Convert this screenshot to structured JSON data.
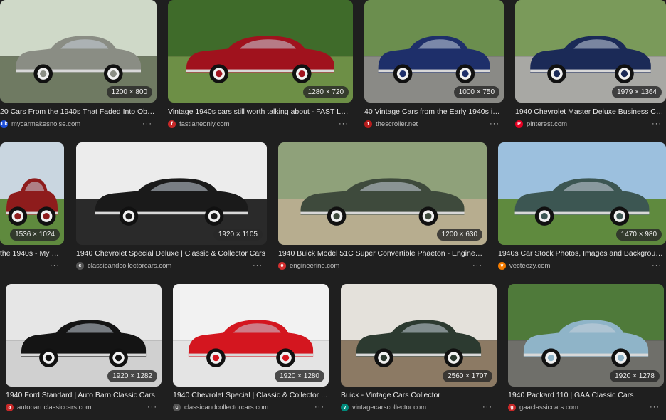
{
  "results": [
    {
      "title": "20 Cars From the 1940s That Faded Into Obs...",
      "source": "mycarmakesnoise.com",
      "dims": "1200 × 800",
      "favicon_color": "#1d4ed8",
      "favicon_label": "Tik",
      "car_color": "#8a8d84",
      "bg_sky": "#cfd9c8",
      "bg_ground": "#6f7a62"
    },
    {
      "title": "Vintage 1940s cars still worth talking about - FAST LA...",
      "source": "fastlaneonly.com",
      "dims": "1280 × 720",
      "favicon_color": "#c62828",
      "favicon_label": "f",
      "car_color": "#a0121d",
      "bg_sky": "#3f6b2a",
      "bg_ground": "#6d8f46"
    },
    {
      "title": "40 Vintage Cars from the Early 1940s in ...",
      "source": "thescroller.net",
      "dims": "1000 × 750",
      "favicon_color": "#b71c1c",
      "favicon_label": "t",
      "car_color": "#1e2f6a",
      "bg_sky": "#6b8e4e",
      "bg_ground": "#8a8a86"
    },
    {
      "title": "1940 Chevrolet Master Deluxe Business Cou...",
      "source": "pinterest.com",
      "dims": "1979 × 1364",
      "favicon_color": "#e60023",
      "favicon_label": "P",
      "car_color": "#1b2a57",
      "bg_sky": "#7a9a5a",
      "bg_ground": "#a8a8a4"
    },
    {
      "title": "the 1940s - My C...",
      "source": "",
      "dims": "1536 × 1024",
      "favicon_color": "#444",
      "favicon_label": "",
      "car_color": "#8e1c1c",
      "bg_sky": "#c9d6e0",
      "bg_ground": "#5f8a3e"
    },
    {
      "title": "1940 Chevrolet Special Deluxe | Classic & Collector Cars",
      "source": "classicandcollectorcars.com",
      "dims": "1920 × 1105",
      "favicon_color": "#555",
      "favicon_label": "c",
      "car_color": "#1a1a1a",
      "bg_sky": "#ececec",
      "bg_ground": "#2a2a2a"
    },
    {
      "title": "1940 Buick Model 51C Super Convertible Phaeton - Engineeri...",
      "source": "engineerine.com",
      "dims": "1200 × 630",
      "favicon_color": "#d32f2f",
      "favicon_label": "e",
      "car_color": "#3e4a3c",
      "bg_sky": "#8fa17a",
      "bg_ground": "#b7ad8f"
    },
    {
      "title": "1940s Car Stock Photos, Images and Backgroun...",
      "source": "vecteezy.com",
      "dims": "1470 × 980",
      "favicon_color": "#f57c00",
      "favicon_label": "v",
      "car_color": "#3c5652",
      "bg_sky": "#9cc0de",
      "bg_ground": "#5f8a3e"
    },
    {
      "title": "1940 Ford Standard | Auto Barn Classic Cars",
      "source": "autobarnclassiccars.com",
      "dims": "1920 × 1282",
      "favicon_color": "#c62828",
      "favicon_label": "a",
      "car_color": "#141414",
      "bg_sky": "#e6e6e6",
      "bg_ground": "#d0d0d0"
    },
    {
      "title": "1940 Chevrolet Special | Classic & Collector ...",
      "source": "classicandcollectorcars.com",
      "dims": "1920 × 1280",
      "favicon_color": "#555",
      "favicon_label": "c",
      "car_color": "#d4161f",
      "bg_sky": "#f2f2f2",
      "bg_ground": "#e4e4e4"
    },
    {
      "title": "Buick - Vintage Cars Collector",
      "source": "vintagecarscollector.com",
      "dims": "2560 × 1707",
      "favicon_color": "#00897b",
      "favicon_label": "v",
      "car_color": "#2c3a30",
      "bg_sky": "#e4e1db",
      "bg_ground": "#8c7a64"
    },
    {
      "title": "1940 Packard 110 | GAA Classic Cars",
      "source": "gaaclassiccars.com",
      "dims": "1920 × 1278",
      "favicon_color": "#c62828",
      "favicon_label": "g",
      "car_color": "#8fb4c8",
      "bg_sky": "#4f7a3a",
      "bg_ground": "#6f6f6a"
    }
  ]
}
